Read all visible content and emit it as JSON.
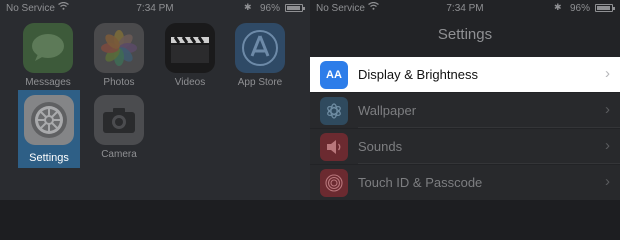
{
  "home": {
    "status": {
      "carrier": "No Service",
      "time": "7:34 PM",
      "battery": "96%",
      "battery_level": 0.96
    },
    "apps": {
      "messages": "Messages",
      "photos": "Photos",
      "videos": "Videos",
      "appstore": "App Store",
      "settings": "Settings",
      "camera": "Camera"
    }
  },
  "settings": {
    "status": {
      "carrier": "No Service",
      "time": "7:34 PM",
      "battery": "96%",
      "battery_level": 0.96
    },
    "title": "Settings",
    "rows": [
      {
        "label": "Display & Brightness",
        "icon": "AA"
      },
      {
        "label": "Wallpaper"
      },
      {
        "label": "Sounds"
      },
      {
        "label": "Touch ID & Passcode"
      }
    ]
  }
}
